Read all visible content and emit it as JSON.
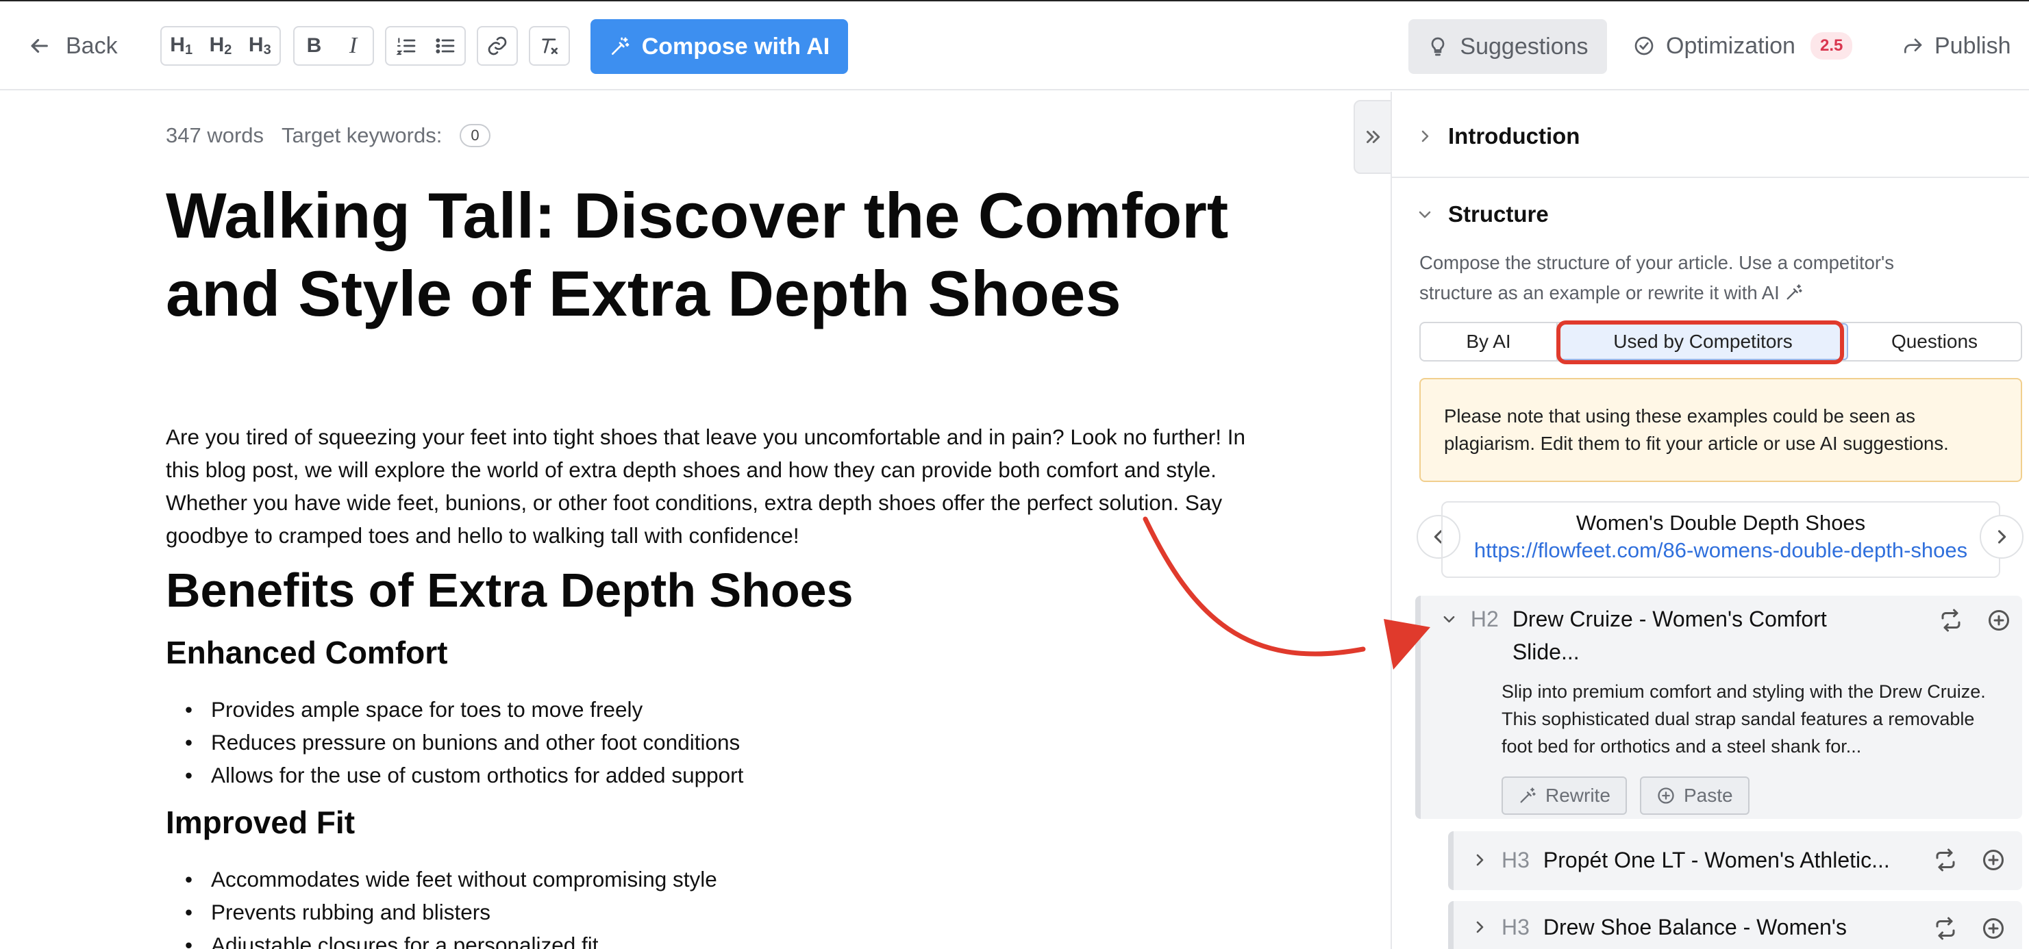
{
  "toolbar": {
    "back_label": "Back",
    "h1_label": "H",
    "h1_num": "1",
    "h2_label": "H",
    "h2_num": "2",
    "h3_label": "H",
    "h3_num": "3",
    "bold_label": "B",
    "italic_label": "I",
    "compose_label": "Compose with AI",
    "suggestions_label": "Suggestions",
    "optimization_label": "Optimization",
    "optimization_score": "2.5",
    "publish_label": "Publish"
  },
  "editor": {
    "word_count": "347 words",
    "target_keywords_label": "Target keywords:",
    "target_keywords_count": "0",
    "title": "Walking Tall: Discover the Comfort and Style of Extra Depth Shoes",
    "intro": "Are you tired of squeezing your feet into tight shoes that leave you uncomfortable and in pain? Look no further! In this blog post, we will explore the world of extra depth shoes and how they can provide both comfort and style. Whether you have wide feet, bunions, or other foot conditions, extra depth shoes offer the perfect solution. Say goodbye to cramped toes and hello to walking tall with confidence!",
    "heading_benefits": "Benefits of Extra Depth Shoes",
    "sub1": {
      "heading": "Enhanced Comfort",
      "items": [
        "Provides ample space for toes to move freely",
        "Reduces pressure on bunions and other foot conditions",
        "Allows for the use of custom orthotics for added support"
      ]
    },
    "sub2": {
      "heading": "Improved Fit",
      "items": [
        "Accommodates wide feet without compromising style",
        "Prevents rubbing and blisters",
        "Adjustable closures for a personalized fit"
      ]
    }
  },
  "panel": {
    "introduction_label": "Introduction",
    "structure_label": "Structure",
    "structure_desc": "Compose the structure of your article. Use a competitor's structure as an example or rewrite it with AI",
    "tabs": [
      "By AI",
      "Used by Competitors",
      "Questions"
    ],
    "notice": "Please note that using these examples could be seen as plagiarism. Edit them to fit your article or use AI suggestions.",
    "competitor": {
      "name": "Women's Double Depth Shoes",
      "url": "https://flowfeet.com/86-womens-double-depth-shoes"
    },
    "h2_item": {
      "level": "H2",
      "title": "Drew Cruize - Women's Comfort Slide...",
      "desc": "Slip into premium comfort and styling with the Drew Cruize. This sophisticated dual strap sandal features a removable foot bed for orthotics and a steel shank for...",
      "rewrite_label": "Rewrite",
      "paste_label": "Paste"
    },
    "h3_items": [
      {
        "level": "H3",
        "title": "Propét One LT - Women's Athletic..."
      },
      {
        "level": "H3",
        "title": "Drew Shoe Balance - Women's"
      }
    ]
  },
  "colors": {
    "accent": "#3d8ff0",
    "annotation": "#e03a2c",
    "notice_bg": "#fff7e6",
    "link": "#2f6fdc"
  }
}
